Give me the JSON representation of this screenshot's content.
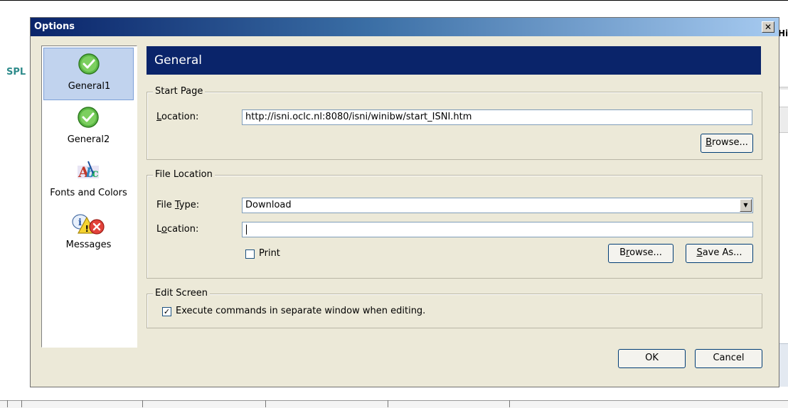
{
  "background": {
    "spl_text": "SPL",
    "hi_text": "Hi"
  },
  "dialog": {
    "title": "Options",
    "close_glyph": "✕"
  },
  "sidebar": {
    "items": [
      {
        "label": "General1",
        "icon": "green-check-icon",
        "selected": true
      },
      {
        "label": "General2",
        "icon": "green-check-icon",
        "selected": false
      },
      {
        "label": "Fonts and Colors",
        "icon": "fonts-colors-abc-icon",
        "selected": false
      },
      {
        "label": "Messages",
        "icon": "messages-info-warning-error-icon",
        "selected": false
      }
    ]
  },
  "header": {
    "title": "General"
  },
  "start_page": {
    "legend": "Start Page",
    "location_label": "Location:",
    "location_value": "http://isni.oclc.nl:8080/isni/winibw/start_ISNI.htm",
    "browse_label": "Browse..."
  },
  "file_location": {
    "legend": "File Location",
    "file_type_label": "File Type:",
    "file_type_value": "Download",
    "location_label": "Location:",
    "location_value": "",
    "print_label": "Print",
    "print_checked": false,
    "browse_label": "Browse...",
    "save_as_label": "Save As..."
  },
  "edit_screen": {
    "legend": "Edit Screen",
    "execute_label": "Execute commands in separate window when editing.",
    "execute_checked": true,
    "check_glyph": "✓"
  },
  "buttons": {
    "ok": "OK",
    "cancel": "Cancel"
  },
  "colors": {
    "header_bg": "#0a246a",
    "dialog_bg": "#ece9d8",
    "selected_item_bg": "#c1d3ee"
  }
}
